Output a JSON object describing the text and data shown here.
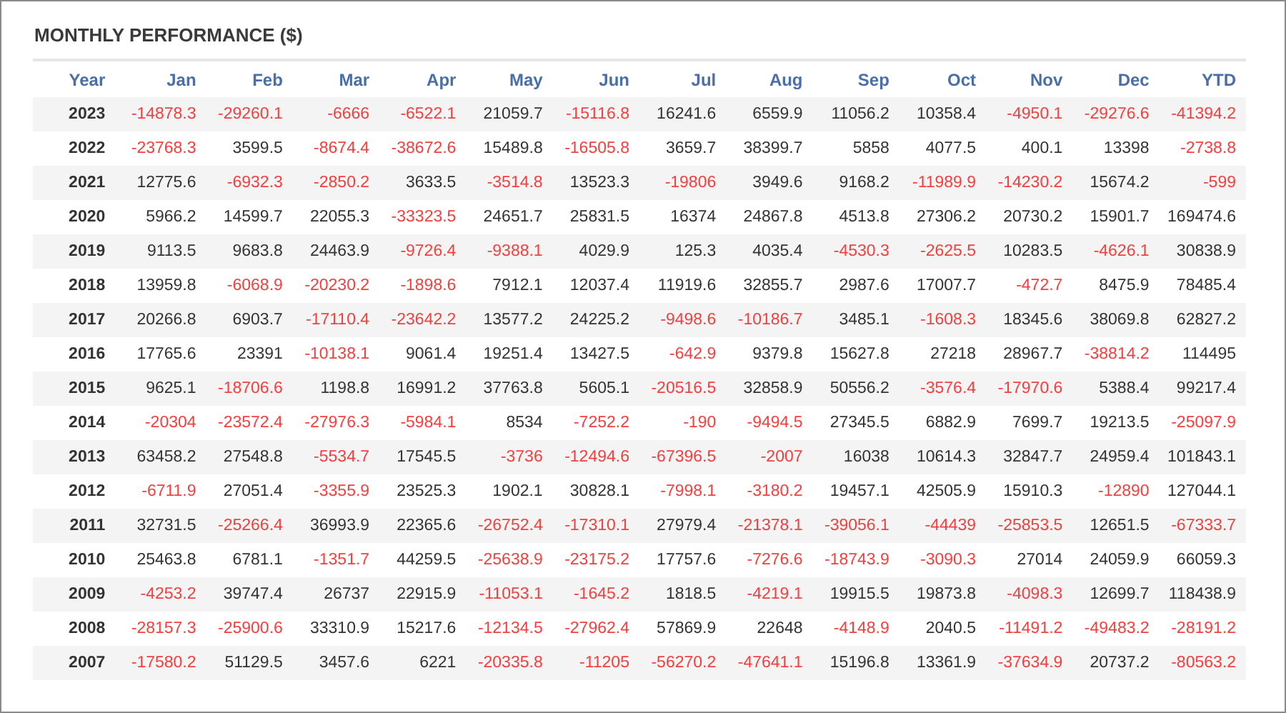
{
  "title": "MONTHLY PERFORMANCE ($)",
  "table": {
    "columns": [
      "Year",
      "Jan",
      "Feb",
      "Mar",
      "Apr",
      "May",
      "Jun",
      "Jul",
      "Aug",
      "Sep",
      "Oct",
      "Nov",
      "Dec",
      "YTD"
    ],
    "rows": [
      {
        "year": "2023",
        "values": [
          "-14878.3",
          "-29260.1",
          "-6666",
          "-6522.1",
          "21059.7",
          "-15116.8",
          "16241.6",
          "6559.9",
          "11056.2",
          "10358.4",
          "-4950.1",
          "-29276.6",
          "-41394.2"
        ]
      },
      {
        "year": "2022",
        "values": [
          "-23768.3",
          "3599.5",
          "-8674.4",
          "-38672.6",
          "15489.8",
          "-16505.8",
          "3659.7",
          "38399.7",
          "5858",
          "4077.5",
          "400.1",
          "13398",
          "-2738.8"
        ]
      },
      {
        "year": "2021",
        "values": [
          "12775.6",
          "-6932.3",
          "-2850.2",
          "3633.5",
          "-3514.8",
          "13523.3",
          "-19806",
          "3949.6",
          "9168.2",
          "-11989.9",
          "-14230.2",
          "15674.2",
          "-599"
        ]
      },
      {
        "year": "2020",
        "values": [
          "5966.2",
          "14599.7",
          "22055.3",
          "-33323.5",
          "24651.7",
          "25831.5",
          "16374",
          "24867.8",
          "4513.8",
          "27306.2",
          "20730.2",
          "15901.7",
          "169474.6"
        ]
      },
      {
        "year": "2019",
        "values": [
          "9113.5",
          "9683.8",
          "24463.9",
          "-9726.4",
          "-9388.1",
          "4029.9",
          "125.3",
          "4035.4",
          "-4530.3",
          "-2625.5",
          "10283.5",
          "-4626.1",
          "30838.9"
        ]
      },
      {
        "year": "2018",
        "values": [
          "13959.8",
          "-6068.9",
          "-20230.2",
          "-1898.6",
          "7912.1",
          "12037.4",
          "11919.6",
          "32855.7",
          "2987.6",
          "17007.7",
          "-472.7",
          "8475.9",
          "78485.4"
        ]
      },
      {
        "year": "2017",
        "values": [
          "20266.8",
          "6903.7",
          "-17110.4",
          "-23642.2",
          "13577.2",
          "24225.2",
          "-9498.6",
          "-10186.7",
          "3485.1",
          "-1608.3",
          "18345.6",
          "38069.8",
          "62827.2"
        ]
      },
      {
        "year": "2016",
        "values": [
          "17765.6",
          "23391",
          "-10138.1",
          "9061.4",
          "19251.4",
          "13427.5",
          "-642.9",
          "9379.8",
          "15627.8",
          "27218",
          "28967.7",
          "-38814.2",
          "114495"
        ]
      },
      {
        "year": "2015",
        "values": [
          "9625.1",
          "-18706.6",
          "1198.8",
          "16991.2",
          "37763.8",
          "5605.1",
          "-20516.5",
          "32858.9",
          "50556.2",
          "-3576.4",
          "-17970.6",
          "5388.4",
          "99217.4"
        ]
      },
      {
        "year": "2014",
        "values": [
          "-20304",
          "-23572.4",
          "-27976.3",
          "-5984.1",
          "8534",
          "-7252.2",
          "-190",
          "-9494.5",
          "27345.5",
          "6882.9",
          "7699.7",
          "19213.5",
          "-25097.9"
        ]
      },
      {
        "year": "2013",
        "values": [
          "63458.2",
          "27548.8",
          "-5534.7",
          "17545.5",
          "-3736",
          "-12494.6",
          "-67396.5",
          "-2007",
          "16038",
          "10614.3",
          "32847.7",
          "24959.4",
          "101843.1"
        ]
      },
      {
        "year": "2012",
        "values": [
          "-6711.9",
          "27051.4",
          "-3355.9",
          "23525.3",
          "1902.1",
          "30828.1",
          "-7998.1",
          "-3180.2",
          "19457.1",
          "42505.9",
          "15910.3",
          "-12890",
          "127044.1"
        ]
      },
      {
        "year": "2011",
        "values": [
          "32731.5",
          "-25266.4",
          "36993.9",
          "22365.6",
          "-26752.4",
          "-17310.1",
          "27979.4",
          "-21378.1",
          "-39056.1",
          "-44439",
          "-25853.5",
          "12651.5",
          "-67333.7"
        ]
      },
      {
        "year": "2010",
        "values": [
          "25463.8",
          "6781.1",
          "-1351.7",
          "44259.5",
          "-25638.9",
          "-23175.2",
          "17757.6",
          "-7276.6",
          "-18743.9",
          "-3090.3",
          "27014",
          "24059.9",
          "66059.3"
        ]
      },
      {
        "year": "2009",
        "values": [
          "-4253.2",
          "39747.4",
          "26737",
          "22915.9",
          "-11053.1",
          "-1645.2",
          "1818.5",
          "-4219.1",
          "19915.5",
          "19873.8",
          "-4098.3",
          "12699.7",
          "118438.9"
        ]
      },
      {
        "year": "2008",
        "values": [
          "-28157.3",
          "-25900.6",
          "33310.9",
          "15217.6",
          "-12134.5",
          "-27962.4",
          "57869.9",
          "22648",
          "-4148.9",
          "2040.5",
          "-11491.2",
          "-49483.2",
          "-28191.2"
        ]
      },
      {
        "year": "2007",
        "values": [
          "-17580.2",
          "51129.5",
          "3457.6",
          "6221",
          "-20335.8",
          "-11205",
          "-56270.2",
          "-47641.1",
          "15196.8",
          "13361.9",
          "-37634.9",
          "20737.2",
          "-80563.2"
        ]
      }
    ]
  }
}
